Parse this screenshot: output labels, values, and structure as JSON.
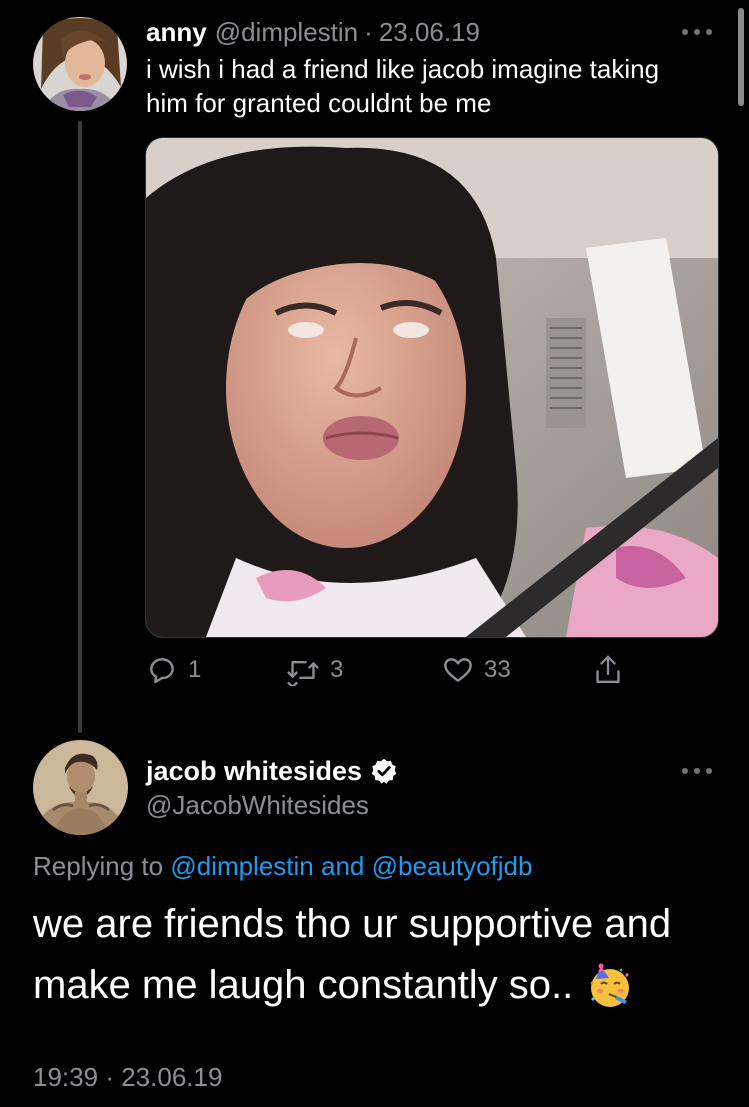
{
  "tweet1": {
    "display_name": "anny",
    "handle": "@dimplestin",
    "separator": "·",
    "date": "23.06.19",
    "text_lines": [
      "i wish i had a friend like jacob imagine taking",
      "him for granted couldnt be me"
    ],
    "actions": {
      "replies": "1",
      "retweets": "3",
      "likes": "33"
    }
  },
  "tweet2": {
    "display_name": "jacob whitesides",
    "handle": "@JacobWhitesides",
    "replying_prefix": "Replying to",
    "replying_user1": "@dimplestin",
    "replying_and": "and",
    "replying_user2": "@beautyofjdb",
    "text_lines": [
      "we are friends tho ur supportive and",
      "make me laugh constantly so.."
    ],
    "emoji": "partying-face",
    "time": "19:39",
    "separator": "·",
    "date": "23.06.19"
  },
  "colors": {
    "background": "#000000",
    "text": "#ffffff",
    "secondary": "#8b8f94",
    "link": "#1d9bf0",
    "thread_line": "#3a3a3a"
  }
}
